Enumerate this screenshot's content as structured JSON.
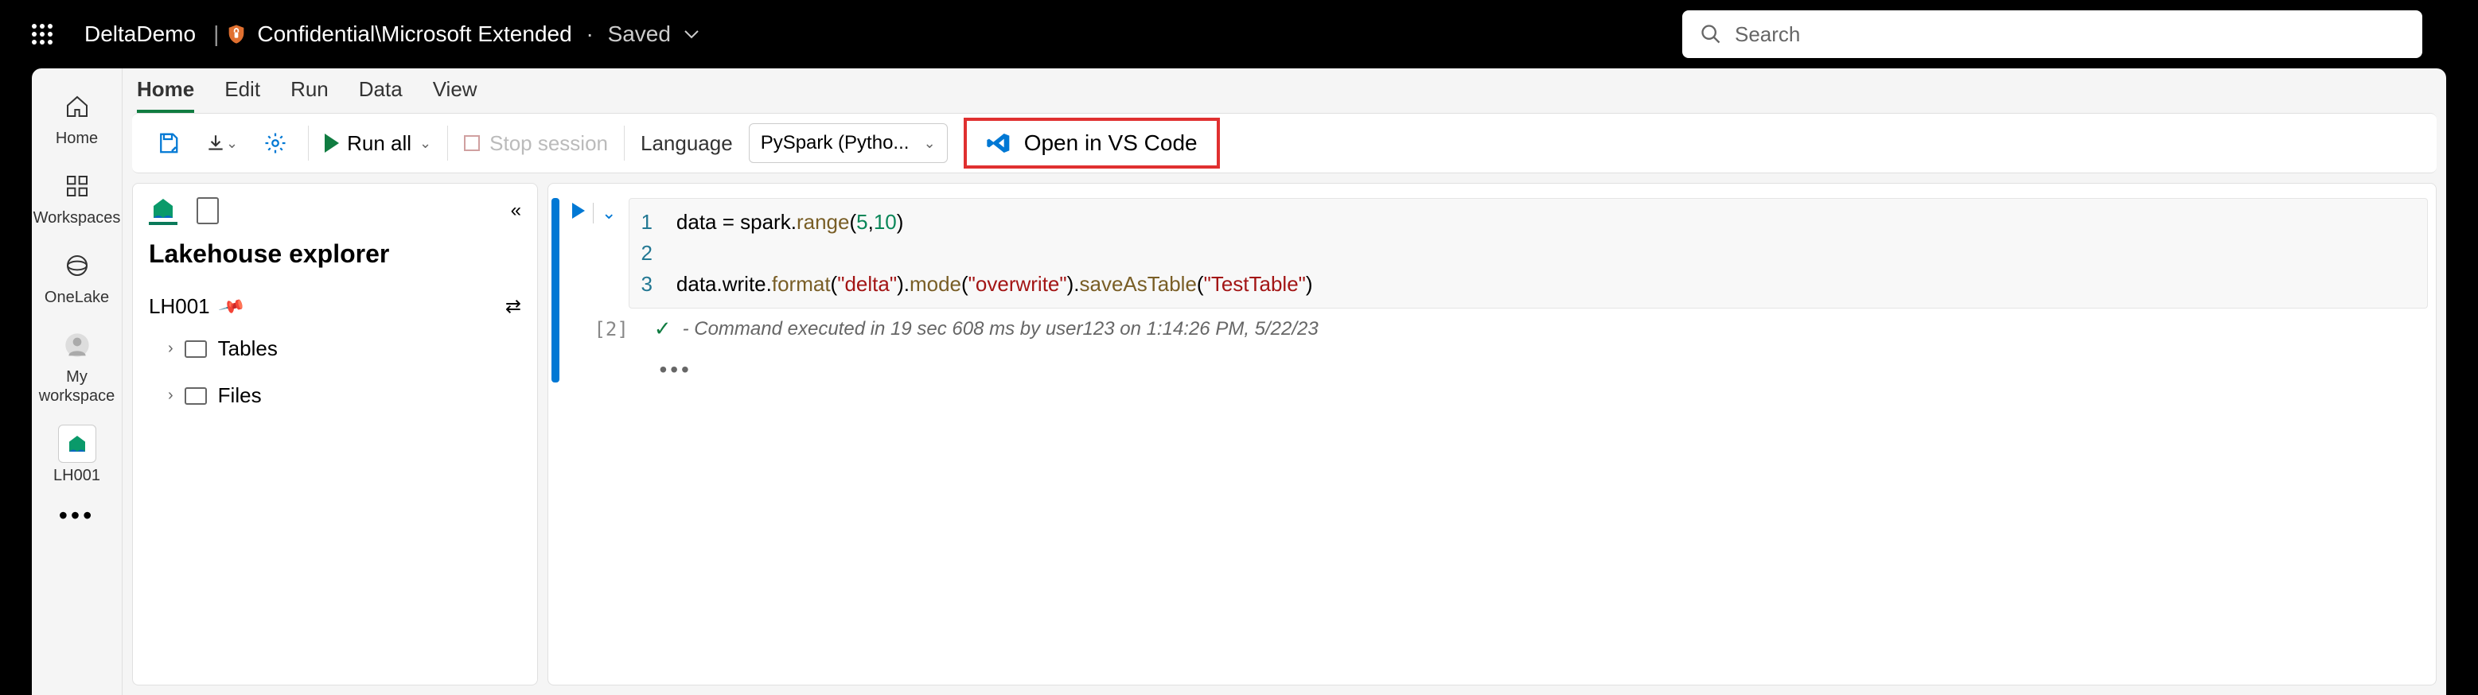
{
  "header": {
    "workspace_name": "DeltaDemo",
    "classification": "Confidential\\Microsoft Extended",
    "saved_status": "Saved",
    "search_placeholder": "Search"
  },
  "rail": {
    "items": [
      {
        "label": "Home"
      },
      {
        "label": "Workspaces"
      },
      {
        "label": "OneLake"
      },
      {
        "label": "My workspace"
      },
      {
        "label": "LH001"
      }
    ]
  },
  "tabs": {
    "items": [
      {
        "label": "Home"
      },
      {
        "label": "Edit"
      },
      {
        "label": "Run"
      },
      {
        "label": "Data"
      },
      {
        "label": "View"
      }
    ]
  },
  "toolbar": {
    "run_all_label": "Run all",
    "stop_session_label": "Stop session",
    "language_label": "Language",
    "language_value": "PySpark (Pytho...",
    "vscode_label": "Open in VS Code"
  },
  "sidebar": {
    "title": "Lakehouse explorer",
    "lakehouse_name": "LH001",
    "tree": {
      "tables": "Tables",
      "files": "Files"
    }
  },
  "notebook": {
    "cell": {
      "exec_count": "[2]",
      "lines": [
        "1",
        "2",
        "3"
      ],
      "code_line1_pre": "data = spark.",
      "code_line1_method": "range",
      "code_line1_open": "(",
      "code_line1_n1": "5",
      "code_line1_comma": ",",
      "code_line1_n2": "10",
      "code_line1_close": ")",
      "code_line3_a": "data.write.",
      "code_line3_m1": "format",
      "code_line3_p1": "(",
      "code_line3_s1": "\"delta\"",
      "code_line3_p1c": ").",
      "code_line3_m2": "mode",
      "code_line3_p2": "(",
      "code_line3_s2": "\"overwrite\"",
      "code_line3_p2c": ").",
      "code_line3_m3": "saveAsTable",
      "code_line3_p3": "(",
      "code_line3_s3": "\"TestTable\"",
      "code_line3_p3c": ")",
      "status": "- Command executed in 19 sec 608 ms by user123 on 1:14:26 PM, 5/22/23"
    }
  }
}
